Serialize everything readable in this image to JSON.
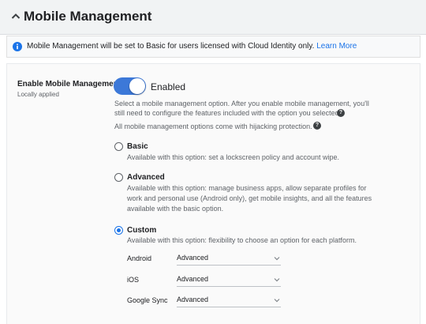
{
  "header": {
    "title": "Mobile Management"
  },
  "banner": {
    "text": "Mobile Management will be set to Basic for users licensed with Cloud Identity only.",
    "link": "Learn More"
  },
  "setting": {
    "label": "Enable Mobile Management",
    "sublabel": "Locally applied",
    "toggle_state": "Enabled",
    "description_line1": "Select a mobile management option. After you enable mobile management, you'll",
    "description_line2": "still need to configure the features included with the option you selected.",
    "hijack_note": "All mobile management options come with hijacking protection."
  },
  "options": [
    {
      "title": "Basic",
      "desc_lines": [
        "Available with this option: set a lockscreen policy and account wipe."
      ],
      "selected": false
    },
    {
      "title": "Advanced",
      "desc_lines": [
        "Available with this option: manage business apps, allow separate profiles for",
        "work and personal use (Android only), get mobile insights, and all the features",
        "available with the basic option."
      ],
      "selected": false
    },
    {
      "title": "Custom",
      "desc_lines": [
        "Available with this option: flexibility to choose an option for each platform."
      ],
      "selected": true
    }
  ],
  "platforms": [
    {
      "label": "Android",
      "value": "Advanced"
    },
    {
      "label": "iOS",
      "value": "Advanced"
    },
    {
      "label": "Google Sync",
      "value": "Advanced"
    }
  ],
  "colors": {
    "accent": "#1a73e8",
    "toggle": "#3c78d8",
    "header_bg": "#f1f3f4"
  },
  "icons": {
    "collapse": "chevron-up-icon",
    "info": "info-icon",
    "help": "help-icon",
    "dropdown": "chevron-down-icon"
  }
}
